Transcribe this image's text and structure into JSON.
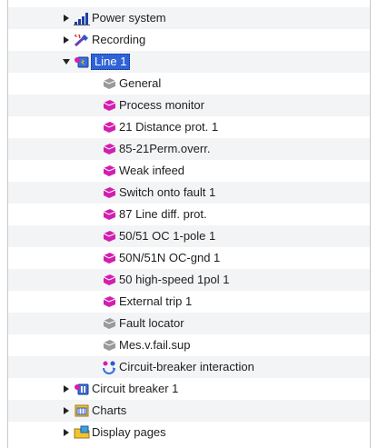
{
  "tree": {
    "power_system": {
      "label": "Power system",
      "icon": "bar-chart-icon"
    },
    "recording": {
      "label": "Recording",
      "icon": "recording-wand-icon"
    },
    "line1": {
      "label": "Line 1",
      "icon": "line-device-icon",
      "expanded": true,
      "selected": true,
      "children": [
        {
          "label": "General",
          "icon": "function-block-gray-icon"
        },
        {
          "label": "Process monitor",
          "icon": "function-block-magenta-icon"
        },
        {
          "label": "21 Distance prot. 1",
          "icon": "function-block-magenta-icon"
        },
        {
          "label": "85-21Perm.overr.",
          "icon": "function-block-magenta-icon"
        },
        {
          "label": "Weak infeed",
          "icon": "function-block-magenta-icon"
        },
        {
          "label": "Switch onto fault 1",
          "icon": "function-block-magenta-icon"
        },
        {
          "label": "87 Line diff. prot.",
          "icon": "function-block-magenta-icon"
        },
        {
          "label": "50/51 OC 1-pole 1",
          "icon": "function-block-magenta-icon"
        },
        {
          "label": "50N/51N OC-gnd 1",
          "icon": "function-block-magenta-icon"
        },
        {
          "label": "50 high-speed 1pol 1",
          "icon": "function-block-magenta-icon"
        },
        {
          "label": "External trip 1",
          "icon": "function-block-magenta-icon"
        },
        {
          "label": "Fault locator",
          "icon": "function-block-gray-icon"
        },
        {
          "label": "Mes.v.fail.sup",
          "icon": "function-block-gray-icon"
        },
        {
          "label": "Circuit-breaker interaction",
          "icon": "interaction-icon"
        }
      ]
    },
    "circuit_breaker": {
      "label": "Circuit breaker 1",
      "icon": "circuit-breaker-icon"
    },
    "charts": {
      "label": "Charts",
      "icon": "charts-icon"
    },
    "display_pages": {
      "label": "Display pages",
      "icon": "display-pages-icon"
    }
  },
  "colors": {
    "selection_bg": "#2f63d6",
    "function_magenta": "#d21fb0",
    "function_gray": "#9a9a9a",
    "row_alt": "#f3f4f6"
  }
}
